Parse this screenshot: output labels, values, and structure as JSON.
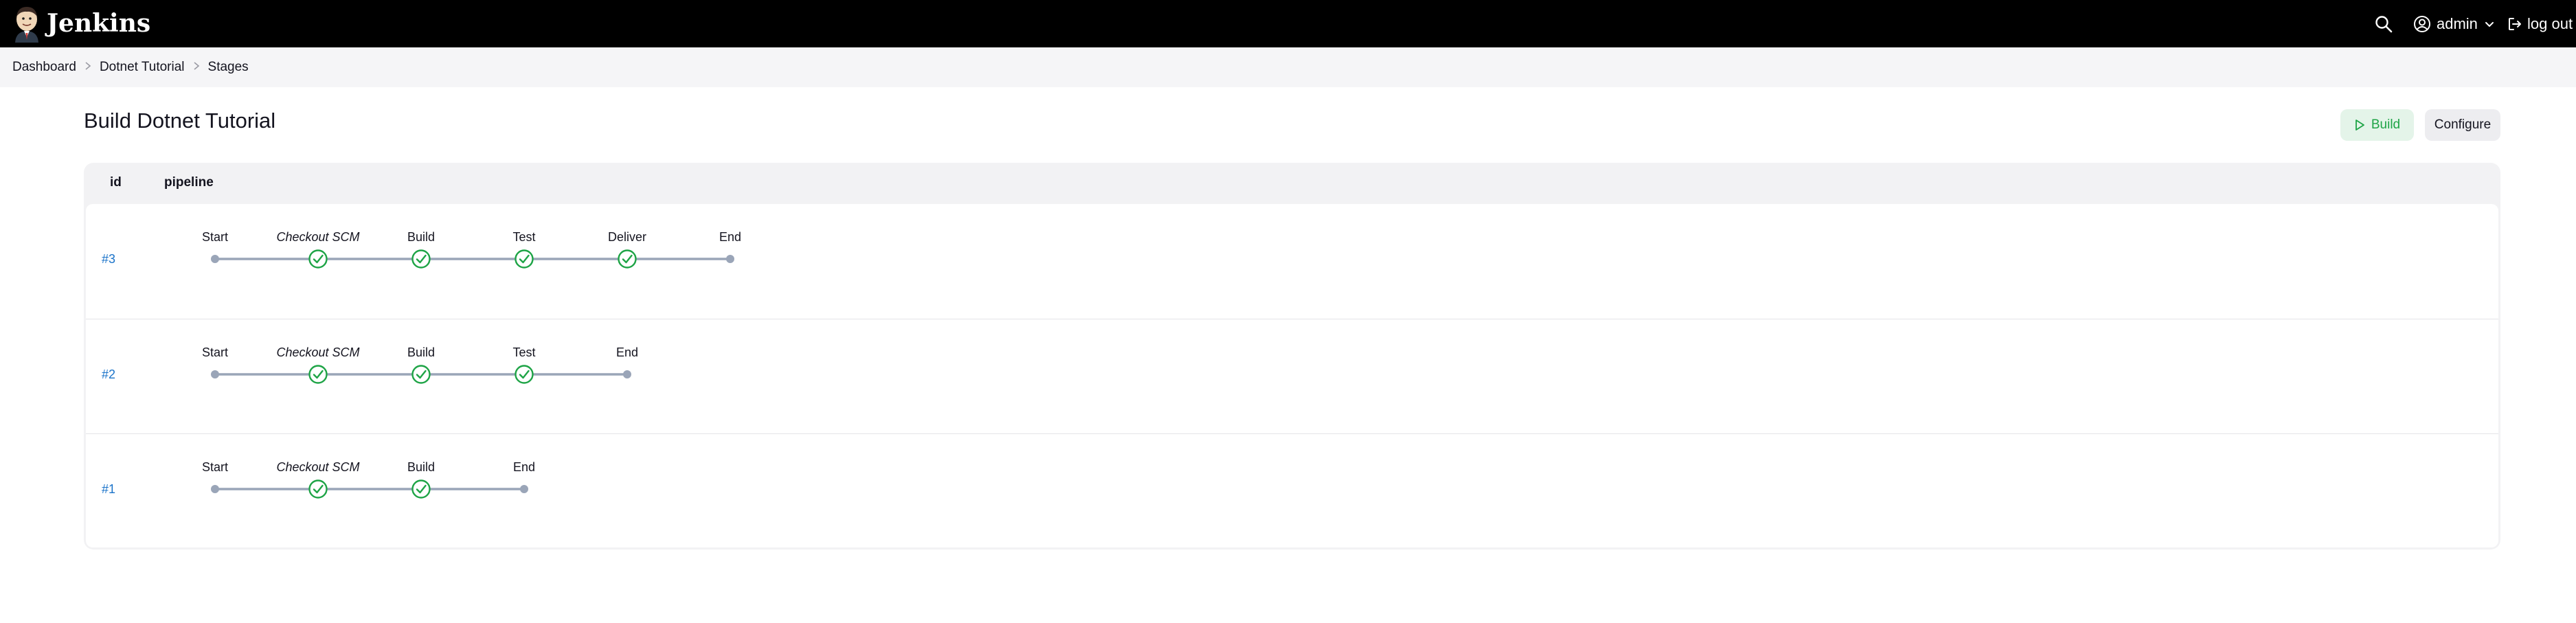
{
  "header": {
    "brand": "Jenkins",
    "user": "admin",
    "logout": "log out",
    "icons": {
      "search": "search-icon",
      "user": "user-circle-icon",
      "chevron": "chevron-down-icon",
      "logout": "logout-icon"
    }
  },
  "breadcrumb": [
    "Dashboard",
    "Dotnet Tutorial",
    "Stages"
  ],
  "page": {
    "title": "Build Dotnet Tutorial",
    "build_button": "Build",
    "configure_button": "Configure"
  },
  "table": {
    "headers": {
      "id": "id",
      "pipeline": "pipeline"
    },
    "rows": [
      {
        "run": "#3",
        "stages": [
          {
            "name": "Start",
            "kind": "endpoint"
          },
          {
            "name": "Checkout SCM",
            "kind": "success",
            "italic": true
          },
          {
            "name": "Build",
            "kind": "success"
          },
          {
            "name": "Test",
            "kind": "success"
          },
          {
            "name": "Deliver",
            "kind": "success"
          },
          {
            "name": "End",
            "kind": "endpoint"
          }
        ]
      },
      {
        "run": "#2",
        "stages": [
          {
            "name": "Start",
            "kind": "endpoint"
          },
          {
            "name": "Checkout SCM",
            "kind": "success",
            "italic": true
          },
          {
            "name": "Build",
            "kind": "success"
          },
          {
            "name": "Test",
            "kind": "success"
          },
          {
            "name": "End",
            "kind": "endpoint"
          }
        ]
      },
      {
        "run": "#1",
        "stages": [
          {
            "name": "Start",
            "kind": "endpoint"
          },
          {
            "name": "Checkout SCM",
            "kind": "success",
            "italic": true
          },
          {
            "name": "Build",
            "kind": "success"
          },
          {
            "name": "End",
            "kind": "endpoint"
          }
        ]
      }
    ]
  },
  "colors": {
    "success": "#1ea446",
    "connector": "#9aa5b8",
    "link": "#1a73c9"
  }
}
